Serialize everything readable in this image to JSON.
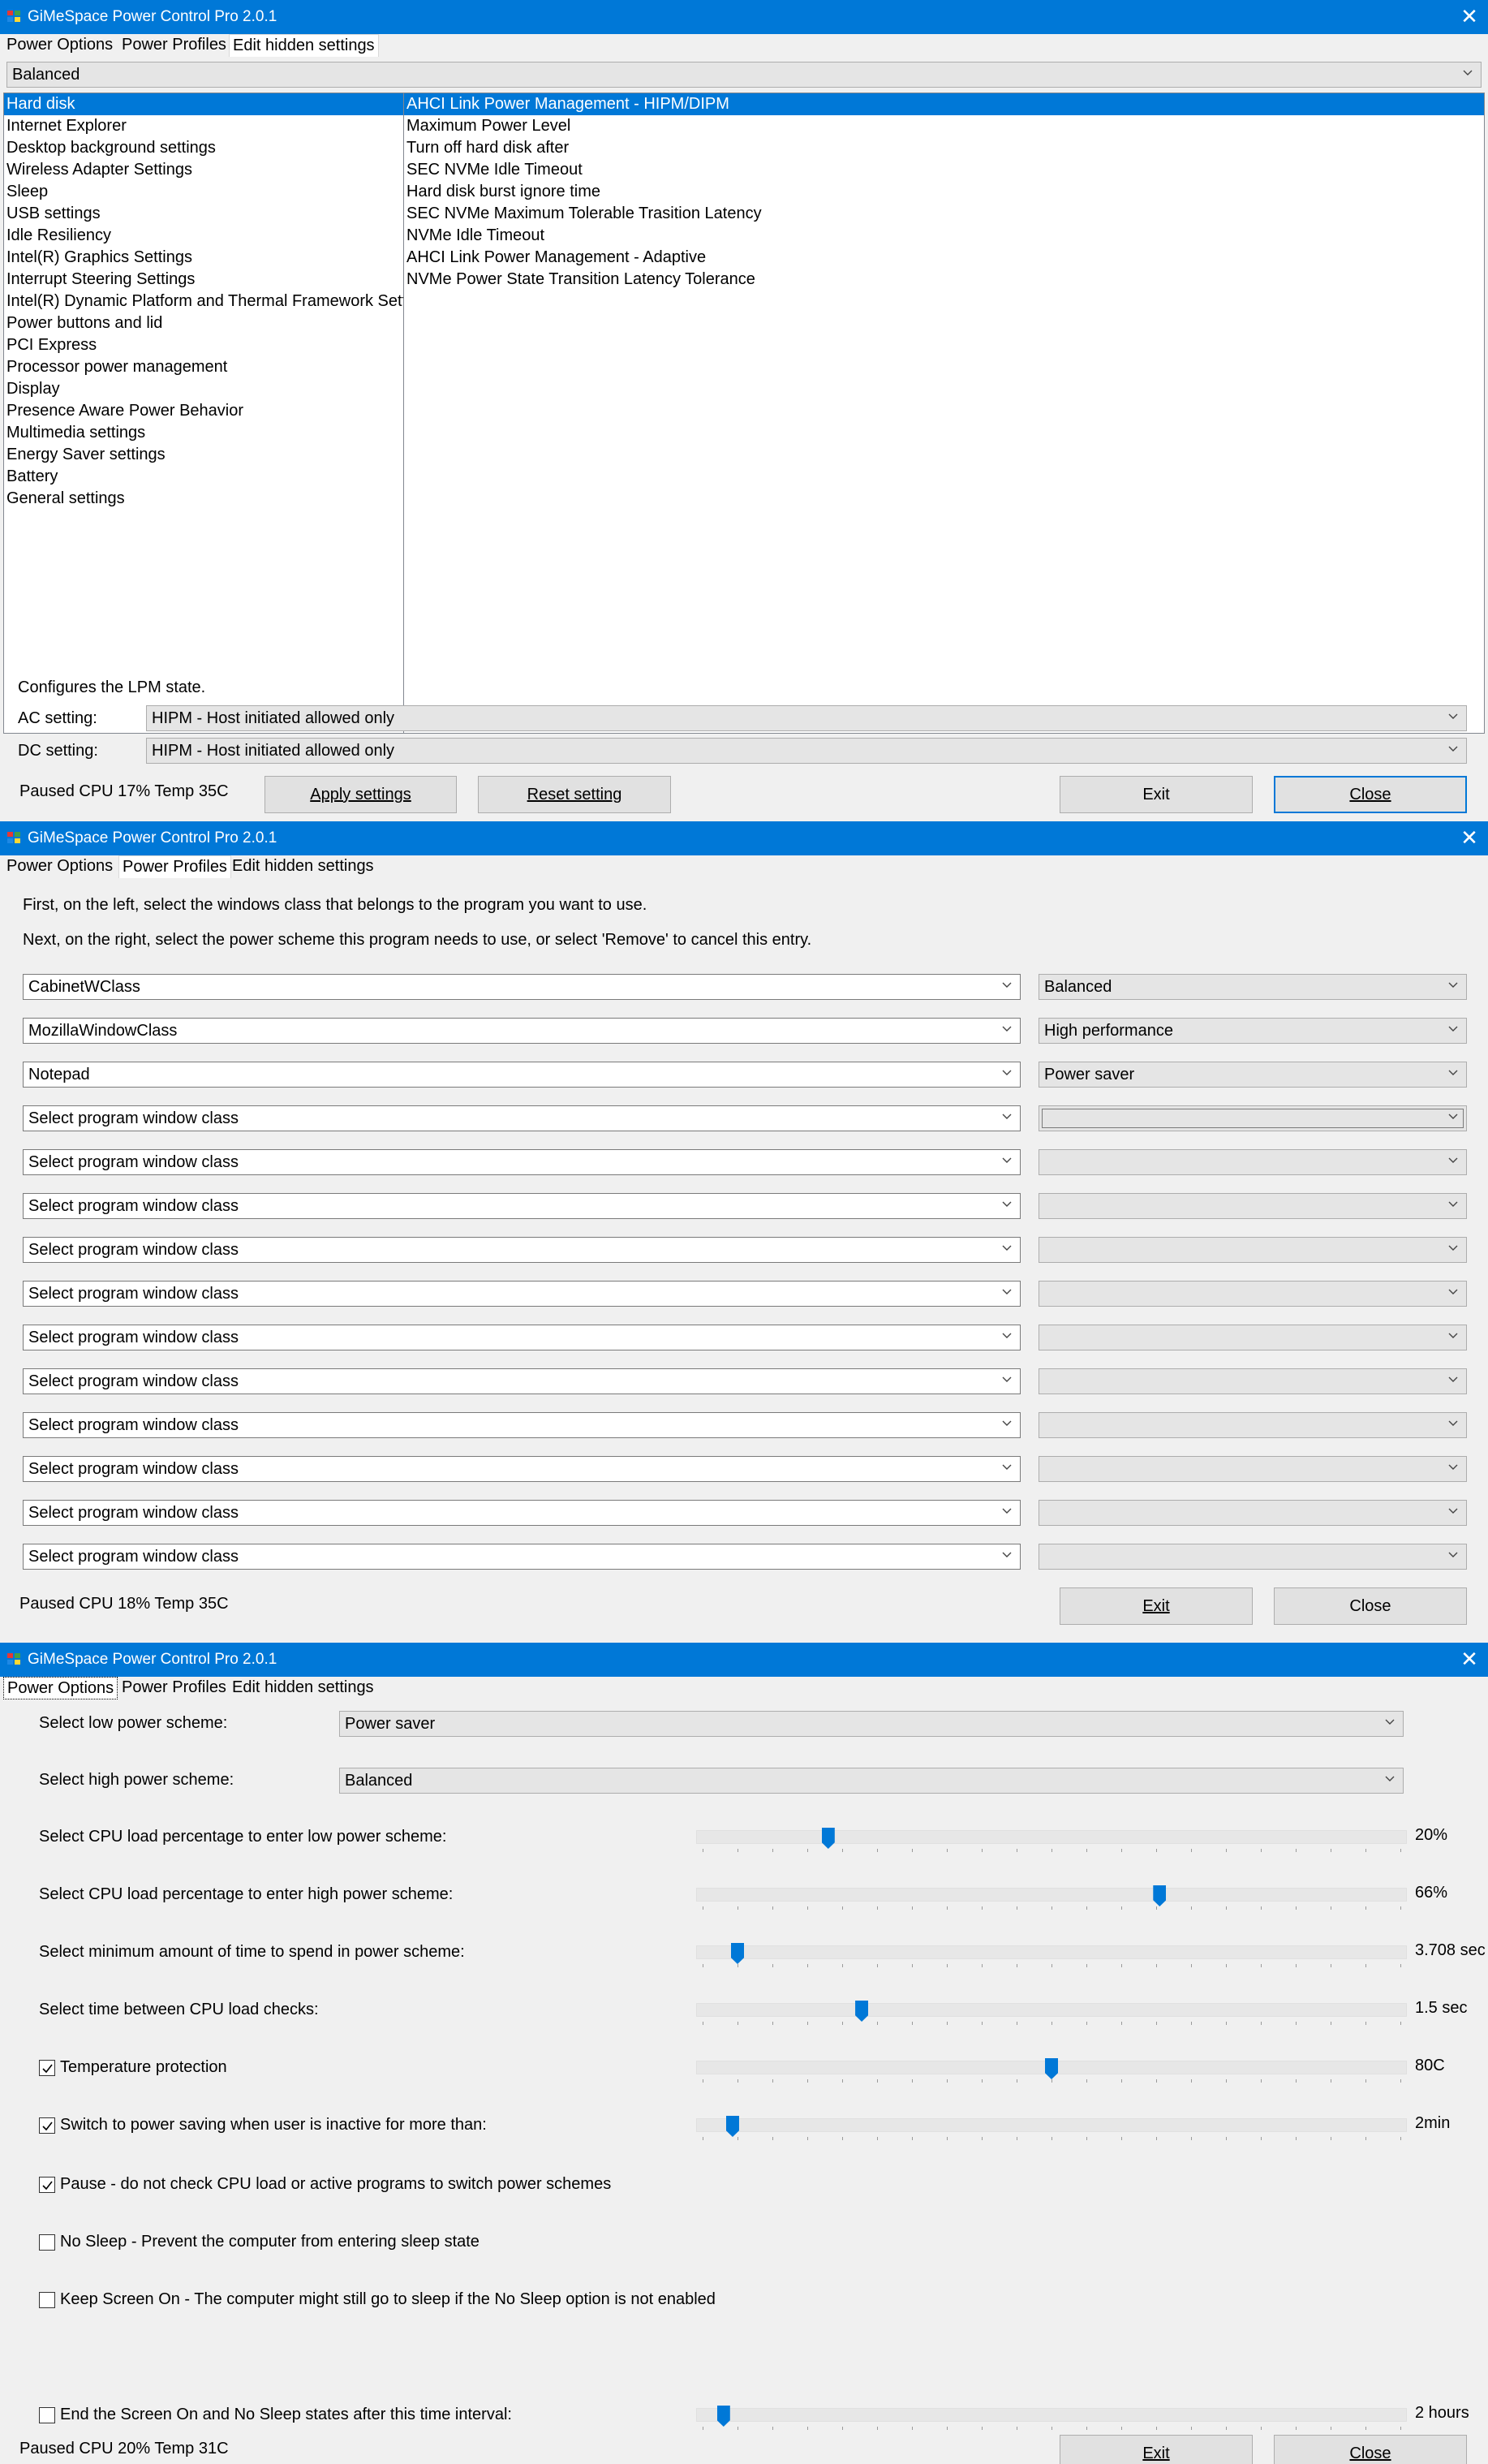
{
  "app": {
    "title": "GiMeSpace Power Control Pro 2.0.1",
    "close_glyph": "✕"
  },
  "tabs": [
    "Power Options",
    "Power Profiles",
    "Edit hidden settings"
  ],
  "hidden": {
    "scheme": "Balanced",
    "categories": [
      "Hard disk",
      "Internet Explorer",
      "Desktop background settings",
      "Wireless Adapter Settings",
      "Sleep",
      "USB settings",
      "Idle Resiliency",
      "Intel(R) Graphics Settings",
      "Interrupt Steering Settings",
      "Intel(R) Dynamic Platform and Thermal Framework Settings",
      "Power buttons and lid",
      "PCI Express",
      "Processor power management",
      "Display",
      "Presence Aware Power Behavior",
      "Multimedia settings",
      "Energy Saver settings",
      "Battery",
      "General settings"
    ],
    "settings": [
      "AHCI Link Power Management - HIPM/DIPM",
      "Maximum Power Level",
      "Turn off hard disk after",
      "SEC NVMe Idle Timeout",
      "Hard disk burst ignore time",
      "SEC NVMe Maximum Tolerable Trasition Latency",
      "NVMe Idle Timeout",
      "AHCI Link Power Management - Adaptive",
      "NVMe Power State Transition Latency Tolerance"
    ],
    "description": "Configures the LPM state.",
    "ac_label": "AC setting:",
    "ac_value": "HIPM - Host initiated allowed only",
    "dc_label": "DC setting:",
    "dc_value": "HIPM - Host initiated allowed only",
    "status": "Paused CPU 17% Temp 35C",
    "apply": "Apply settings",
    "reset": "Reset setting",
    "exit": "Exit",
    "close": "Close"
  },
  "profiles": {
    "instr1": "First, on the left, select the windows class that belongs to the program you want to use.",
    "instr2": "Next, on the right, select the power scheme this program needs to use, or select 'Remove' to cancel this entry.",
    "rows": [
      {
        "cls": "CabinetWClass",
        "scheme": "Balanced"
      },
      {
        "cls": "MozillaWindowClass",
        "scheme": "High performance"
      },
      {
        "cls": "Notepad",
        "scheme": "Power saver"
      },
      {
        "cls": "Select program window class",
        "scheme": ""
      },
      {
        "cls": "Select program window class",
        "scheme": ""
      },
      {
        "cls": "Select program window class",
        "scheme": ""
      },
      {
        "cls": "Select program window class",
        "scheme": ""
      },
      {
        "cls": "Select program window class",
        "scheme": ""
      },
      {
        "cls": "Select program window class",
        "scheme": ""
      },
      {
        "cls": "Select program window class",
        "scheme": ""
      },
      {
        "cls": "Select program window class",
        "scheme": ""
      },
      {
        "cls": "Select program window class",
        "scheme": ""
      },
      {
        "cls": "Select program window class",
        "scheme": ""
      },
      {
        "cls": "Select program window class",
        "scheme": ""
      }
    ],
    "status": "Paused CPU 18% Temp 35C",
    "exit": "Exit",
    "close": "Close"
  },
  "options": {
    "low_label": "Select low power scheme:",
    "low_value": "Power saver",
    "high_label": "Select high power scheme:",
    "high_value": "Balanced",
    "sliders": [
      {
        "label": "Select CPU load percentage to enter low power scheme:",
        "value": "20%",
        "level": 0.18,
        "checkbox": false
      },
      {
        "label": "Select CPU load percentage to enter high power scheme:",
        "value": "66%",
        "level": 0.655,
        "checkbox": false
      },
      {
        "label": "Select minimum amount of time to spend in power scheme:",
        "value": "3.708 sec",
        "level": 0.05,
        "checkbox": false
      },
      {
        "label": "Select time between CPU load checks:",
        "value": "1.5 sec",
        "level": 0.228,
        "checkbox": false
      },
      {
        "label": "Temperature protection",
        "value": "80C",
        "level": 0.5,
        "checkbox": true,
        "checked": true
      },
      {
        "label": "Switch to power saving when user is inactive for more than:",
        "value": "2min",
        "level": 0.043,
        "checkbox": true,
        "checked": true
      }
    ],
    "checks": [
      {
        "label": "Pause - do not check CPU load or active programs to switch power schemes",
        "checked": true
      },
      {
        "label": "No Sleep - Prevent the computer from entering sleep state",
        "checked": false
      },
      {
        "label": "Keep Screen On - The computer might still go to sleep if the No Sleep option is not enabled",
        "checked": false
      }
    ],
    "end_label": "End the Screen On and No Sleep states after this time interval:",
    "end_value": "2 hours",
    "end_level": 0.03,
    "end_checked": false,
    "status": "Paused CPU 20% Temp 31C",
    "exit": "Exit",
    "close": "Close"
  }
}
